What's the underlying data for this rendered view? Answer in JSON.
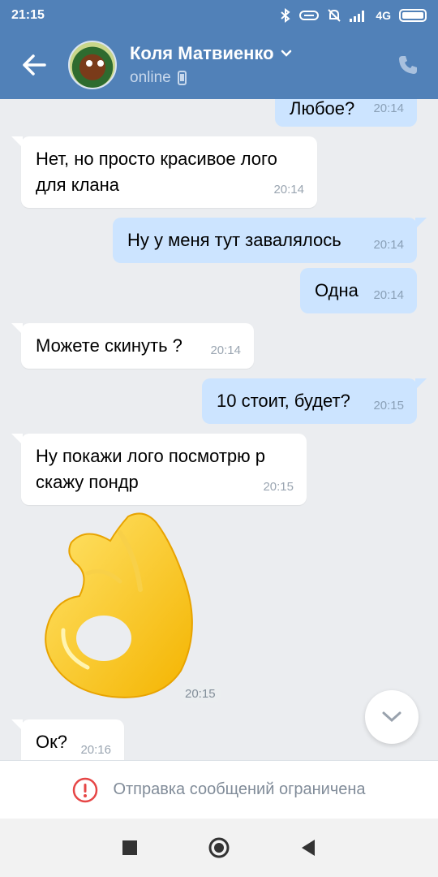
{
  "status_bar": {
    "time": "21:15",
    "network": "4G"
  },
  "header": {
    "contact_name": "Коля Матвиенко",
    "status": "online",
    "icons": [
      "back-arrow-icon",
      "chevron-down-icon",
      "mobile-device-icon",
      "phone-icon"
    ]
  },
  "messages": [
    {
      "dir": "out",
      "text": "Любое?",
      "time": "20:14"
    },
    {
      "dir": "in",
      "text": "Нет, но просто красивое лого для клана",
      "time": "20:14"
    },
    {
      "dir": "out",
      "text": "Ну у меня тут завалялось",
      "time": "20:14"
    },
    {
      "dir": "out",
      "text": "Одна",
      "time": "20:14"
    },
    {
      "dir": "in",
      "text": "Можете скинуть ?",
      "time": "20:14"
    },
    {
      "dir": "out",
      "text": "10 стоит, будет?",
      "time": "20:15"
    },
    {
      "dir": "in",
      "text": "Ну покажи лого посмотрю р скажу пондр",
      "time": "20:15"
    },
    {
      "dir": "in",
      "type": "sticker",
      "sticker": "ok-hand-sticker",
      "time": "20:15"
    },
    {
      "dir": "in",
      "text": "Ок?",
      "time": "20:16"
    }
  ],
  "restriction": {
    "text": "Отправка сообщений ограничена",
    "icon": "exclamation-circle-icon",
    "color": "#e64646"
  },
  "colors": {
    "header_bg": "#5181b8",
    "chat_bg": "#ebedf0",
    "outgoing_bubble": "#cce4ff",
    "incoming_bubble": "#ffffff"
  }
}
